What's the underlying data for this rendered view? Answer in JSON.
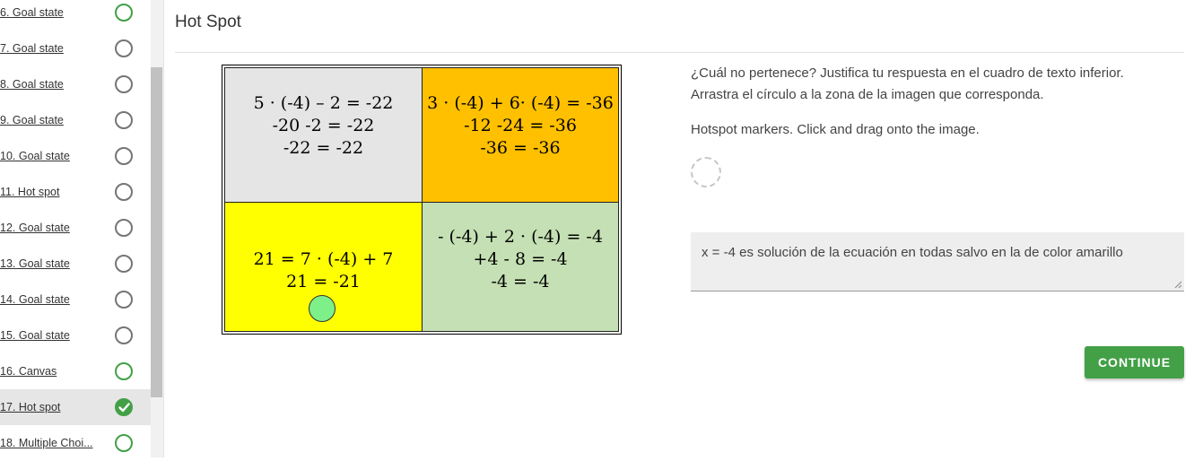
{
  "sidebar": {
    "items": [
      {
        "label": "6. Goal state",
        "status": "green"
      },
      {
        "label": "7. Goal state",
        "status": "gray"
      },
      {
        "label": "8. Goal state",
        "status": "gray"
      },
      {
        "label": "9. Goal state",
        "status": "gray"
      },
      {
        "label": "10. Goal state",
        "status": "gray"
      },
      {
        "label": "11. Hot spot",
        "status": "gray"
      },
      {
        "label": "12. Goal state",
        "status": "gray"
      },
      {
        "label": "13. Goal state",
        "status": "gray"
      },
      {
        "label": "14. Goal state",
        "status": "gray"
      },
      {
        "label": "15. Goal state",
        "status": "gray"
      },
      {
        "label": "16. Canvas",
        "status": "green"
      },
      {
        "label": "17. Hot spot",
        "status": "done"
      },
      {
        "label": "18. Multiple Choi...",
        "status": "green"
      }
    ]
  },
  "page": {
    "title": "Hot Spot"
  },
  "hotspot": {
    "cells": [
      {
        "lines": [
          "5 · (-4) – 2 = -22",
          "-20 -2 = -22",
          "-22 = -22"
        ],
        "color": "#e5e5e5"
      },
      {
        "lines": [
          "3 · (-4) + 6· (-4) = -36",
          "-12 -24 = -36",
          "-36 = -36"
        ],
        "color": "#ffc000"
      },
      {
        "lines": [
          "21 = 7 · (-4) + 7",
          "21 = -21"
        ],
        "color": "#ffff00"
      },
      {
        "lines": [
          "- (-4) + 2 · (-4) = -4",
          "+4 - 8 = -4",
          "-4 = -4"
        ],
        "color": "#c5e0b4"
      }
    ],
    "marker_color": "#7ef08a"
  },
  "question": {
    "line1": "¿Cuál no pertenece? Justifica tu respuesta en el cuadro de texto inferior.",
    "line2": "Arrastra el círculo a la zona de la imagen que corresponda.",
    "markers_label": "Hotspot markers. Click and drag onto the image."
  },
  "answer": {
    "value": "x = -4 es solución de la ecuación en todas salvo en la de color amarillo"
  },
  "actions": {
    "continue_label": "CONTINUE"
  },
  "colors": {
    "accent": "#43a047"
  }
}
